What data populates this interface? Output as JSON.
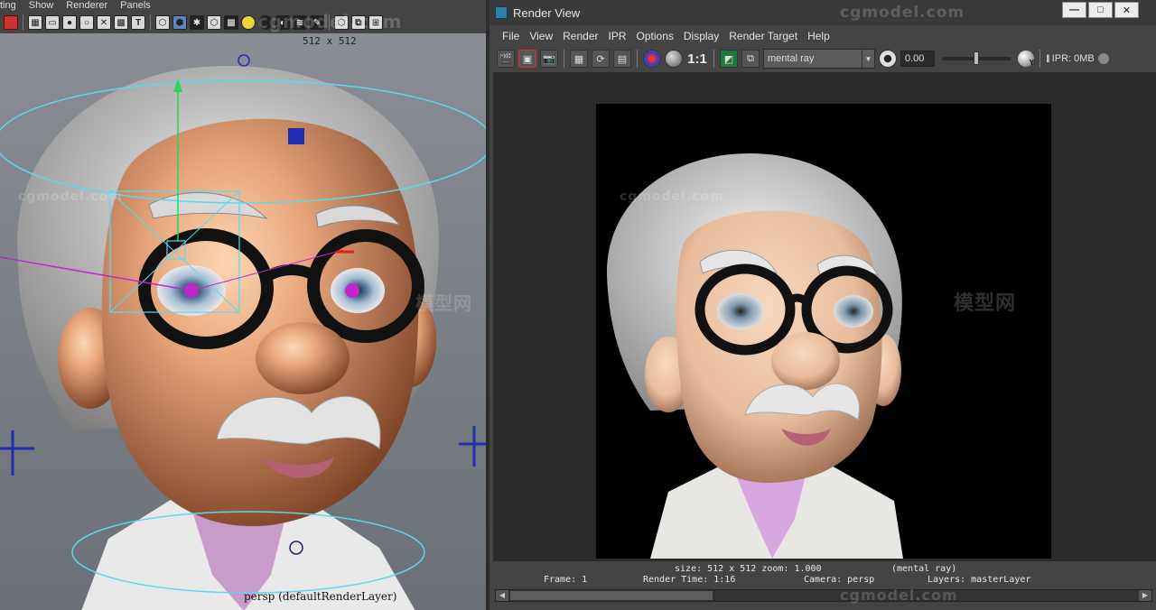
{
  "viewport": {
    "menu": [
      "ting",
      "Show",
      "Renderer",
      "Panels"
    ],
    "resolution_label": "512 x 512",
    "camera_label": "persp (defaultRenderLayer)",
    "icons": [
      "select-icon",
      "grid-icon",
      "film-gate-icon",
      "camera-icon",
      "resolution-gate-icon",
      "texture-icon",
      "text-icon",
      "wireframe-icon",
      "smooth-shade-icon",
      "default-light-icon",
      "all-lights-icon",
      "textured-icon",
      "isolate-icon",
      "xray-icon",
      "xray-joints-icon",
      "grease-pencil-icon"
    ]
  },
  "render_view": {
    "title": "Render View",
    "window_buttons": {
      "minimize": "—",
      "maximize": "□",
      "close": "✕"
    },
    "menu": [
      "File",
      "View",
      "Render",
      "IPR",
      "Options",
      "Display",
      "Render Target",
      "Help"
    ],
    "toolbar": {
      "one_to_one": "1:1",
      "renderer": "mental ray",
      "exposure": "0.00",
      "exposure_level": 0.5,
      "gamma_label": "Y",
      "pause": "II",
      "ipr_memory": "IPR: 0MB"
    },
    "status": {
      "size": "size: 512 x 512 zoom: 1.000",
      "renderer": "(mental ray)",
      "frame": "Frame: 1",
      "render_time": "Render Time:  1:16",
      "camera": "Camera: persp",
      "layers": "Layers: masterLayer"
    }
  },
  "watermarks": {
    "top": "cgmodel.com",
    "brand_cn": "模型网",
    "bottom": "cgmodel.com"
  },
  "colors": {
    "manipulator_cyan": "#5ad8f0",
    "manipulator_magenta": "#c026c8",
    "manipulator_blue": "#1f2fb0",
    "skin": "#e9a77c",
    "hair": "#d8d8d8"
  }
}
